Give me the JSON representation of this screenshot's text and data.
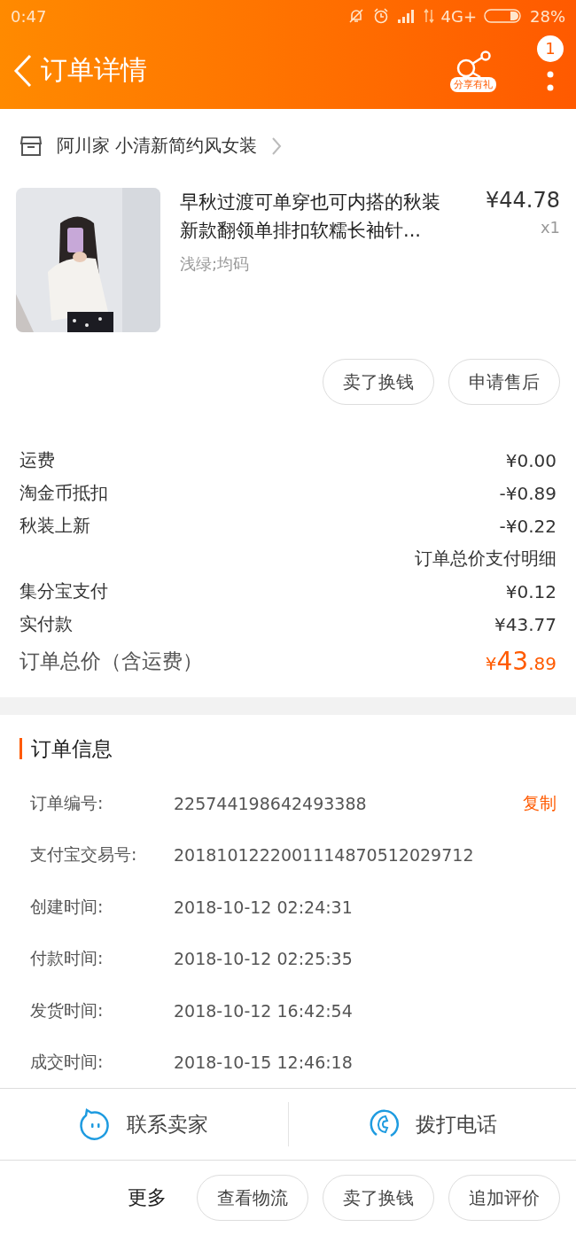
{
  "status_bar": {
    "time": "0:47",
    "network": "4G+",
    "battery": "28%"
  },
  "header": {
    "title": "订单详情",
    "share_label": "分享有礼",
    "badge": "1"
  },
  "shop": {
    "name": "阿川家 小清新简约风女装"
  },
  "product": {
    "kind": "picture",
    "title": "早秋过渡可单穿也可内搭的秋装新款翻领单排扣软糯长袖针...",
    "price": "¥44.78",
    "quantity": "x1",
    "variant": "浅绿;均码"
  },
  "product_buttons": [
    "卖了换钱",
    "申请售后"
  ],
  "costs": [
    {
      "label": "运费",
      "value": "¥0.00"
    },
    {
      "label": "淘金币抵扣",
      "value": "-¥0.89"
    },
    {
      "label": "秋装上新",
      "value": "-¥0.22"
    },
    {
      "value": "订单总价支付明细"
    },
    {
      "label": "集分宝支付",
      "value": "¥0.12"
    },
    {
      "label": "实付款",
      "value": "¥43.77"
    }
  ],
  "total": {
    "label": "订单总价（含运费）",
    "currency": "¥",
    "integer": "43",
    "fraction": ".89"
  },
  "order_info": {
    "title": "订单信息",
    "rows": [
      {
        "label": "订单编号:",
        "value": "225744198642493388",
        "action": "复制"
      },
      {
        "label": "支付宝交易号:",
        "value": "2018101222001114870512029712"
      },
      {
        "label": "创建时间:",
        "value": "2018-10-12 02:24:31"
      },
      {
        "label": "付款时间:",
        "value": "2018-10-12 02:25:35"
      },
      {
        "label": "发货时间:",
        "value": "2018-10-12 16:42:54"
      },
      {
        "label": "成交时间:",
        "value": "2018-10-15 12:46:18"
      }
    ]
  },
  "contact_bar": [
    {
      "kind": "chat",
      "label": "联系卖家"
    },
    {
      "kind": "phone",
      "label": "拨打电话"
    }
  ],
  "more_bar": {
    "label": "更多",
    "buttons": [
      "查看物流",
      "卖了换钱",
      "追加评价"
    ]
  }
}
